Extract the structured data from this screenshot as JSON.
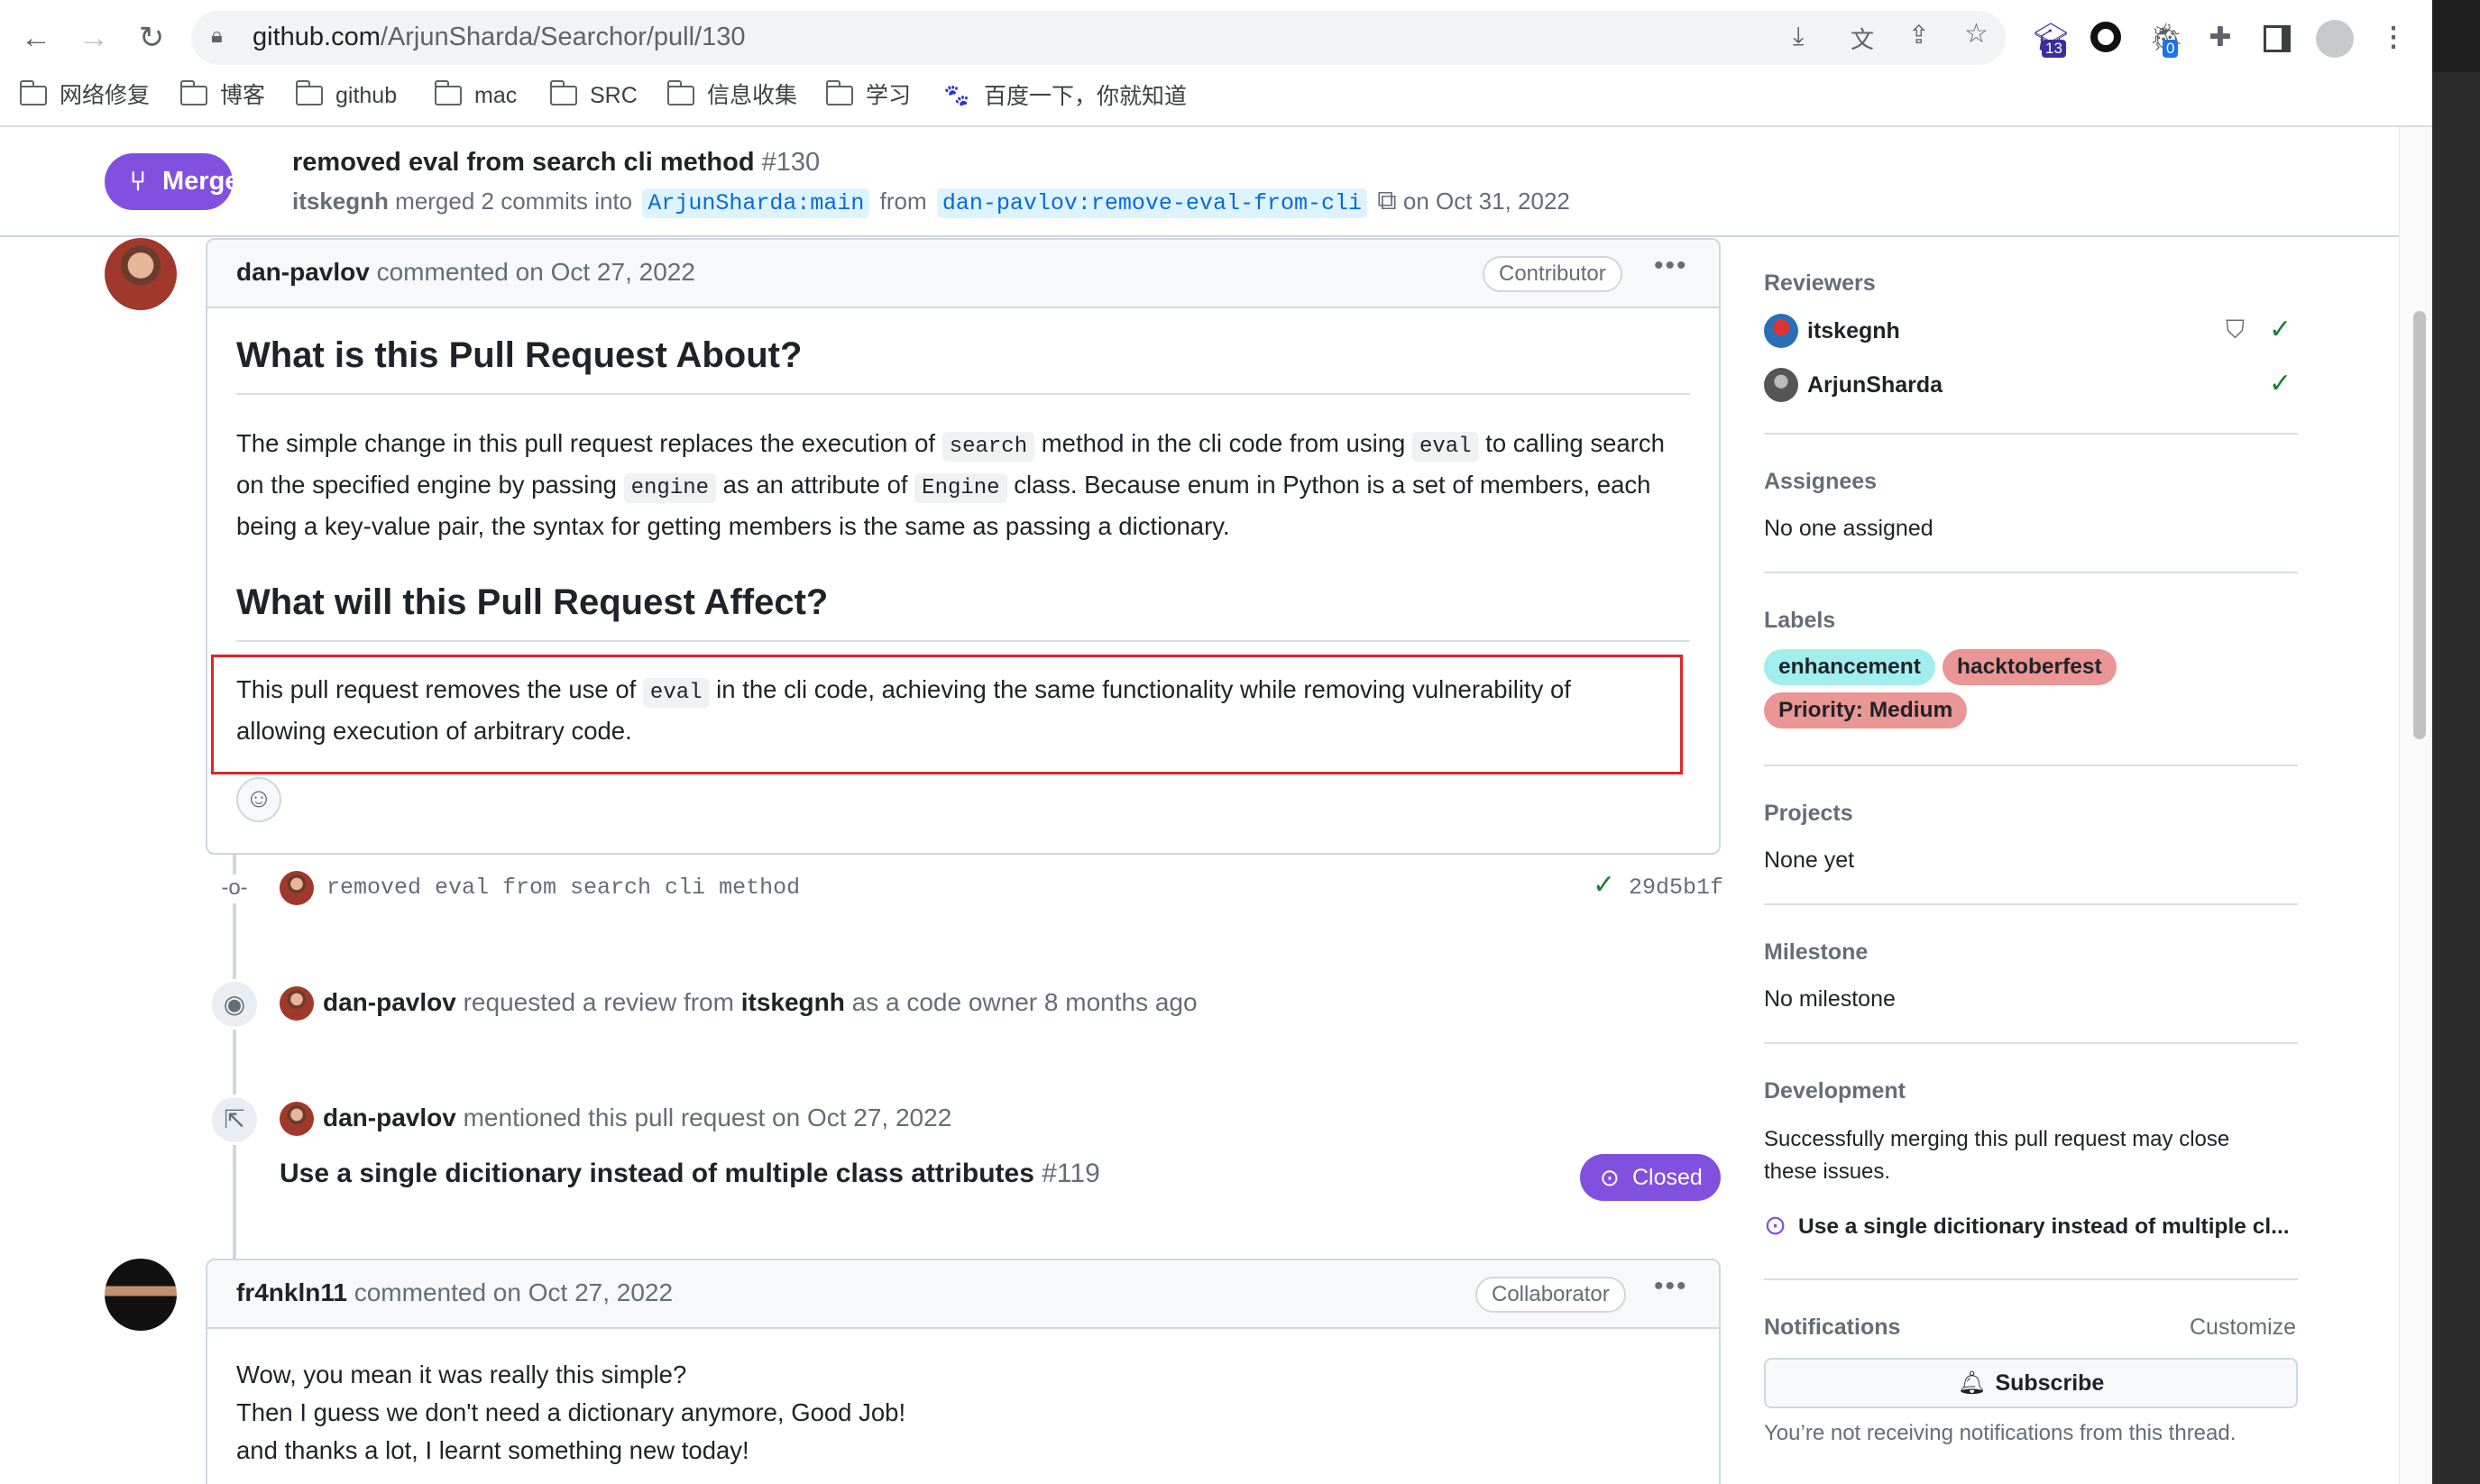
{
  "browser": {
    "url_host": "github.com",
    "url_path": "/ArjunSharda/Searchor/pull/130",
    "ext_badge_1": "13",
    "ext_badge_2": "0",
    "bookmarks": [
      "网络修复",
      "博客",
      "github",
      "mac",
      "SRC",
      "信息收集",
      "学习",
      "百度一下，你就知道"
    ]
  },
  "pr": {
    "status": "Merged",
    "title": "removed eval from search cli method",
    "number": "#130",
    "merger": "itskegnh",
    "merged_text": "merged 2 commits into",
    "base_branch": "ArjunSharda:main",
    "from_text": "from",
    "head_branch": "dan-pavlov:remove-eval-from-cli",
    "date_text": "on Oct 31, 2022"
  },
  "comment1": {
    "author": "dan-pavlov",
    "meta": "commented on Oct 27, 2022",
    "role": "Contributor",
    "menu": "•••",
    "h1": "What is this Pull Request About?",
    "p1_a": "The simple change in this pull request replaces the execution of ",
    "p1_code1": "search",
    "p1_b": " method in the cli code from using ",
    "p1_code2": "eval",
    "p1_c": " to calling search on the specified engine by passing ",
    "p1_code3": "engine",
    "p1_d": " as an attribute of ",
    "p1_code4": "Engine",
    "p1_e": " class. Because enum in Python is a set of members, each being a key-value pair, the syntax for getting members is the same as passing a dictionary.",
    "h2": "What will this Pull Request Affect?",
    "p2_a": "This pull request removes the use of ",
    "p2_code": "eval",
    "p2_b": " in the cli code, achieving the same functionality while removing vulnerability of allowing execution of arbitrary code."
  },
  "timeline": {
    "commit_msg": "removed eval from search cli method",
    "commit_sha": "29d5b1f",
    "review_actor": "dan-pavlov",
    "review_text_a": "requested a review from",
    "review_target": "itskegnh",
    "review_text_b": "as a code owner 8 months ago",
    "mention_actor": "dan-pavlov",
    "mention_text": "mentioned this pull request on Oct 27, 2022",
    "ref_title": "Use a single dicitionary instead of multiple class attributes",
    "ref_number": "#119",
    "ref_status": "Closed"
  },
  "comment2": {
    "author": "fr4nkln11",
    "meta": "commented on Oct 27, 2022",
    "role": "Collaborator",
    "menu": "•••",
    "line1": "Wow, you mean it was really this simple?",
    "line2": "Then I guess we don't need a dictionary anymore, Good Job!",
    "line3": "and thanks a lot, I learnt something new today!"
  },
  "sidebar": {
    "reviewers_h": "Reviewers",
    "reviewer1": "itskegnh",
    "reviewer2": "ArjunSharda",
    "assignees_h": "Assignees",
    "assignees_v": "No one assigned",
    "labels_h": "Labels",
    "labels": [
      {
        "name": "enhancement",
        "color": "#a2eeef"
      },
      {
        "name": "hacktoberfest",
        "color": "#e99695"
      },
      {
        "name": "Priority: Medium",
        "color": "#e99695"
      }
    ],
    "projects_h": "Projects",
    "projects_v": "None yet",
    "milestone_h": "Milestone",
    "milestone_v": "No milestone",
    "development_h": "Development",
    "development_v": "Successfully merging this pull request may close these issues.",
    "development_link": "Use a single dicitionary instead of multiple cl...",
    "notifications_h": "Notifications",
    "customize": "Customize",
    "subscribe": "Subscribe",
    "notif_note": "You’re not receiving notifications from this thread."
  },
  "colors": {
    "merged": "#8250df",
    "link": "#0969da",
    "success": "#1a7f37",
    "highlight_box": "#e0242a"
  }
}
